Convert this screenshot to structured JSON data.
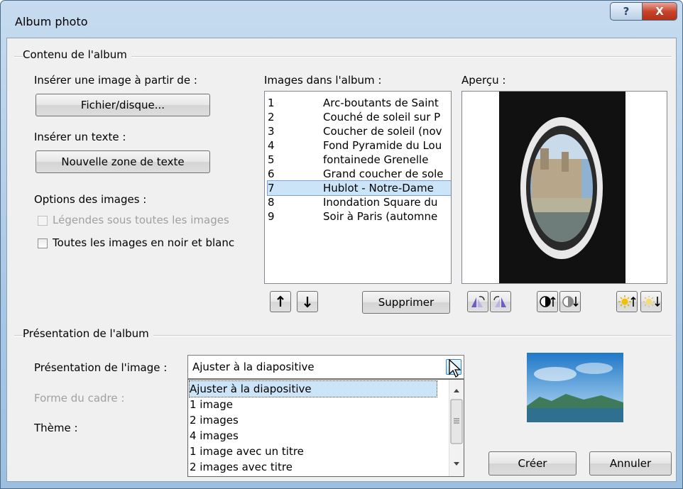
{
  "window": {
    "title": "Album photo",
    "help_label": "?",
    "close_label": "X"
  },
  "content_group": {
    "title": "Contenu de l'album",
    "insert_image_label": "Insérer une image à partir de :",
    "file_button": "Fichier/disque...",
    "insert_text_label": "Insérer un texte :",
    "new_textbox_button": "Nouvelle zone de texte",
    "image_options_label": "Options des images :",
    "captions_checkbox": "Légendes sous toutes les images",
    "bw_checkbox": "Toutes les images en noir et blanc",
    "images_in_album_label": "Images dans l'album :",
    "images": [
      {
        "num": "1",
        "name": "Arc-boutants de Saint"
      },
      {
        "num": "2",
        "name": "Couché de soleil sur P"
      },
      {
        "num": "3",
        "name": "Coucher de soleil (nov"
      },
      {
        "num": "4",
        "name": "Fond Pyramide du Lou"
      },
      {
        "num": "5",
        "name": "fontainede Grenelle"
      },
      {
        "num": "6",
        "name": "Grand coucher de sole"
      },
      {
        "num": "7",
        "name": "Hublot - Notre-Dame"
      },
      {
        "num": "8",
        "name": "Inondation Square du"
      },
      {
        "num": "9",
        "name": "Soir à Paris (automne"
      }
    ],
    "selected_index": 6,
    "move_up_icon": "arrow-up-icon",
    "move_down_icon": "arrow-down-icon",
    "delete_button": "Supprimer",
    "preview_label": "Aperçu :"
  },
  "layout_group": {
    "title": "Présentation de l'album",
    "picture_layout_label": "Présentation de l'image :",
    "picture_layout_value": "Ajuster à la diapositive",
    "frame_shape_label": "Forme du cadre :",
    "theme_label": "Thème :",
    "dropdown_options": [
      "Ajuster à la diapositive",
      "1 image",
      "2 images",
      "4 images",
      "1 image avec un titre",
      "2 images avec titre"
    ],
    "dropdown_selected": 0
  },
  "buttons": {
    "create": "Créer",
    "cancel": "Annuler"
  },
  "colors": {
    "selection": "#cce4f7",
    "close_button": "#c8452c"
  }
}
